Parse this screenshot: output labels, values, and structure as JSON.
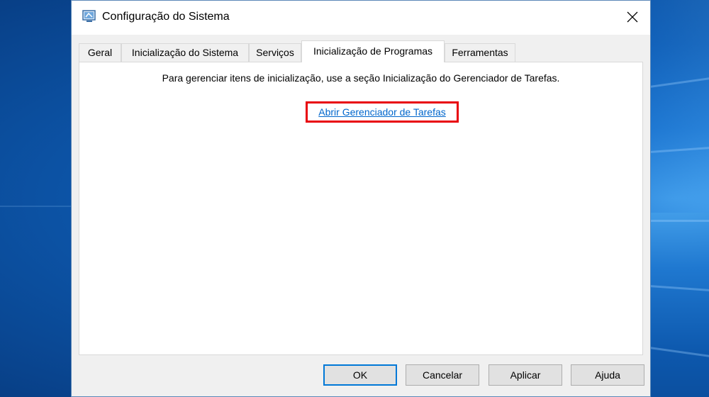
{
  "window": {
    "title": "Configuração do Sistema",
    "icon": "system-config-icon",
    "close_icon": "close-icon"
  },
  "tabs": [
    {
      "label": "Geral",
      "active": false
    },
    {
      "label": "Inicialização do Sistema",
      "active": false
    },
    {
      "label": "Serviços",
      "active": false
    },
    {
      "label": "Inicialização de Programas",
      "active": true
    },
    {
      "label": "Ferramentas",
      "active": false
    }
  ],
  "panel": {
    "info_text": "Para gerenciar itens de inicialização, use a seção Inicialização do Gerenciador de Tarefas.",
    "link_text": "Abrir Gerenciador de Tarefas",
    "highlight_color": "#e8000b"
  },
  "buttons": {
    "ok": "OK",
    "cancel": "Cancelar",
    "apply": "Aplicar",
    "help": "Ajuda"
  },
  "colors": {
    "link": "#0066cc",
    "default_button_border": "#0078d7",
    "desktop_blue": "#0d58ad"
  }
}
